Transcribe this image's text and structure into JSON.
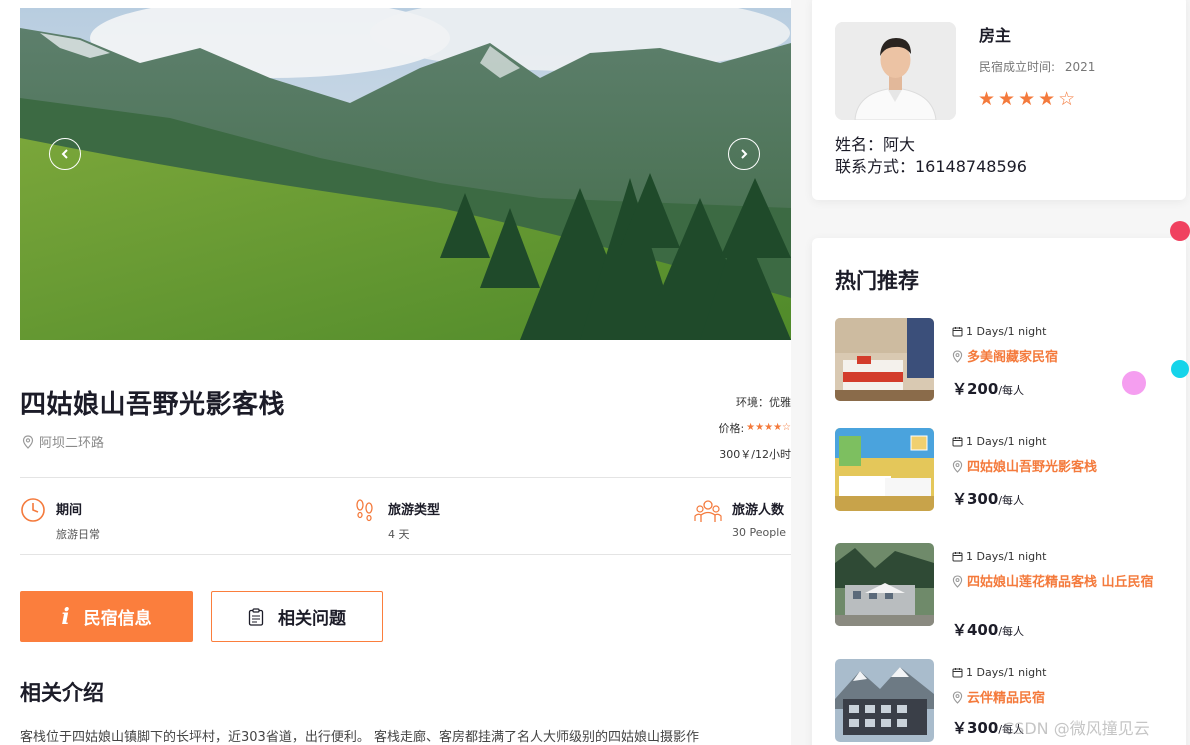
{
  "listing": {
    "title": "四姑娘山吾野光影客栈",
    "address": "阿坝二环路",
    "environment": "环境：优雅",
    "price_label": "价格:",
    "rating_stars": "★★★★☆",
    "rate": "300￥/12小时"
  },
  "features": [
    {
      "title": "期间",
      "value": "旅游日常",
      "icon": "clock-icon"
    },
    {
      "title": "旅游类型",
      "value": "4 天",
      "icon": "footprints-icon"
    },
    {
      "title": "旅游人数",
      "value": "30 People",
      "icon": "people-icon"
    }
  ],
  "buttons": {
    "info": "民宿信息",
    "faq": "相关问题"
  },
  "intro": {
    "title": "相关介绍",
    "text": "客栈位于四姑娘山镇脚下的长坪村，近303省道，出行便利。 客栈走廊、客房都挂满了名人大师级别的四姑娘山摄影作"
  },
  "host": {
    "role": "房主",
    "since_label": "民宿成立时间:",
    "since_year": "2021",
    "stars": "★★★★☆",
    "name": "姓名：阿大",
    "phone": "联系方式：16148748596"
  },
  "hot": {
    "title": "热门推荐",
    "items": [
      {
        "duration": "1 Days/1 night",
        "name": "多美阁藏家民宿",
        "price": "￥200",
        "unit": "/每人"
      },
      {
        "duration": "1 Days/1 night",
        "name": "四姑娘山吾野光影客栈",
        "price": "￥300",
        "unit": "/每人"
      },
      {
        "duration": "1 Days/1 night",
        "name": "四姑娘山莲花精品客栈 山丘民宿",
        "price": "￥400",
        "unit": "/每人"
      },
      {
        "duration": "1 Days/1 night",
        "name": "云伴精品民宿",
        "price": "￥300",
        "unit": "/每人"
      }
    ]
  },
  "watermark": "CSDN @微风撞见云",
  "colors": {
    "accent": "#fb7e3d",
    "star": "#f47a3c",
    "text": "#1c1c28"
  }
}
